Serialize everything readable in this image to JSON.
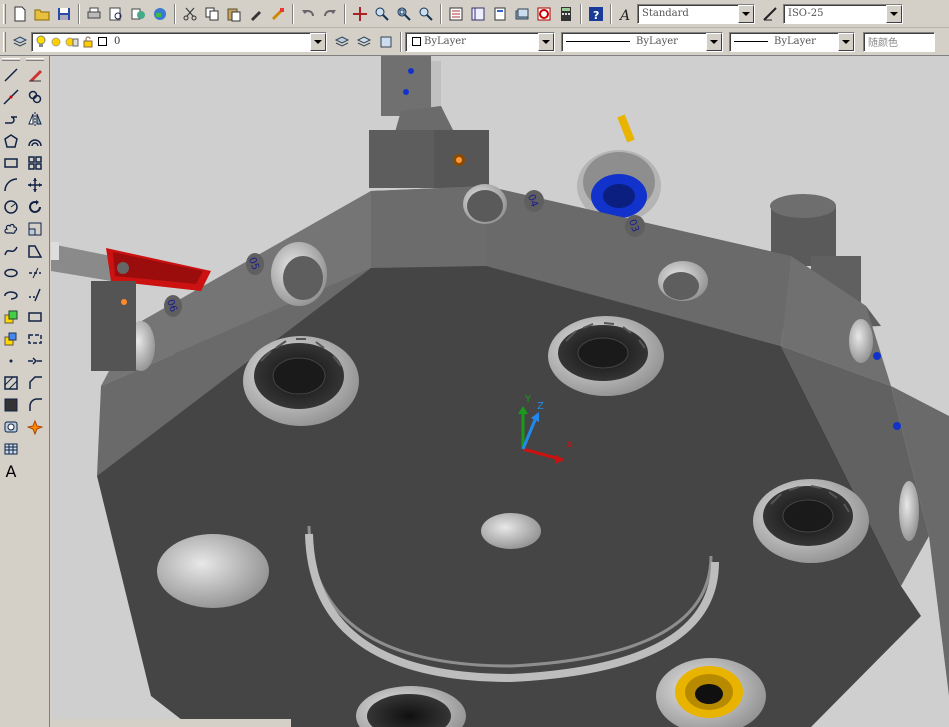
{
  "toolbar": {
    "text_style": "Standard",
    "dim_style": "ISO-25"
  },
  "layers": {
    "current_layer": "0",
    "color": "ByLayer",
    "linetype": "ByLayer",
    "lineweight": "ByLayer",
    "plot_style": "随颜色"
  },
  "draw_panel": {
    "text_tool": "A"
  },
  "viewport": {
    "labels": [
      "06",
      "05",
      "04",
      "03"
    ],
    "ucs": {
      "x": "X",
      "y": "Y",
      "z": "Z"
    }
  },
  "colors": {
    "ui_face": "#d4d0c8",
    "viewport_bg": "#cfcfcf",
    "body_dark": "#454545",
    "body_side": "#6e6e6e",
    "accent_red": "#cc1111",
    "accent_blue": "#1133cc",
    "accent_gold": "#e8b400"
  }
}
